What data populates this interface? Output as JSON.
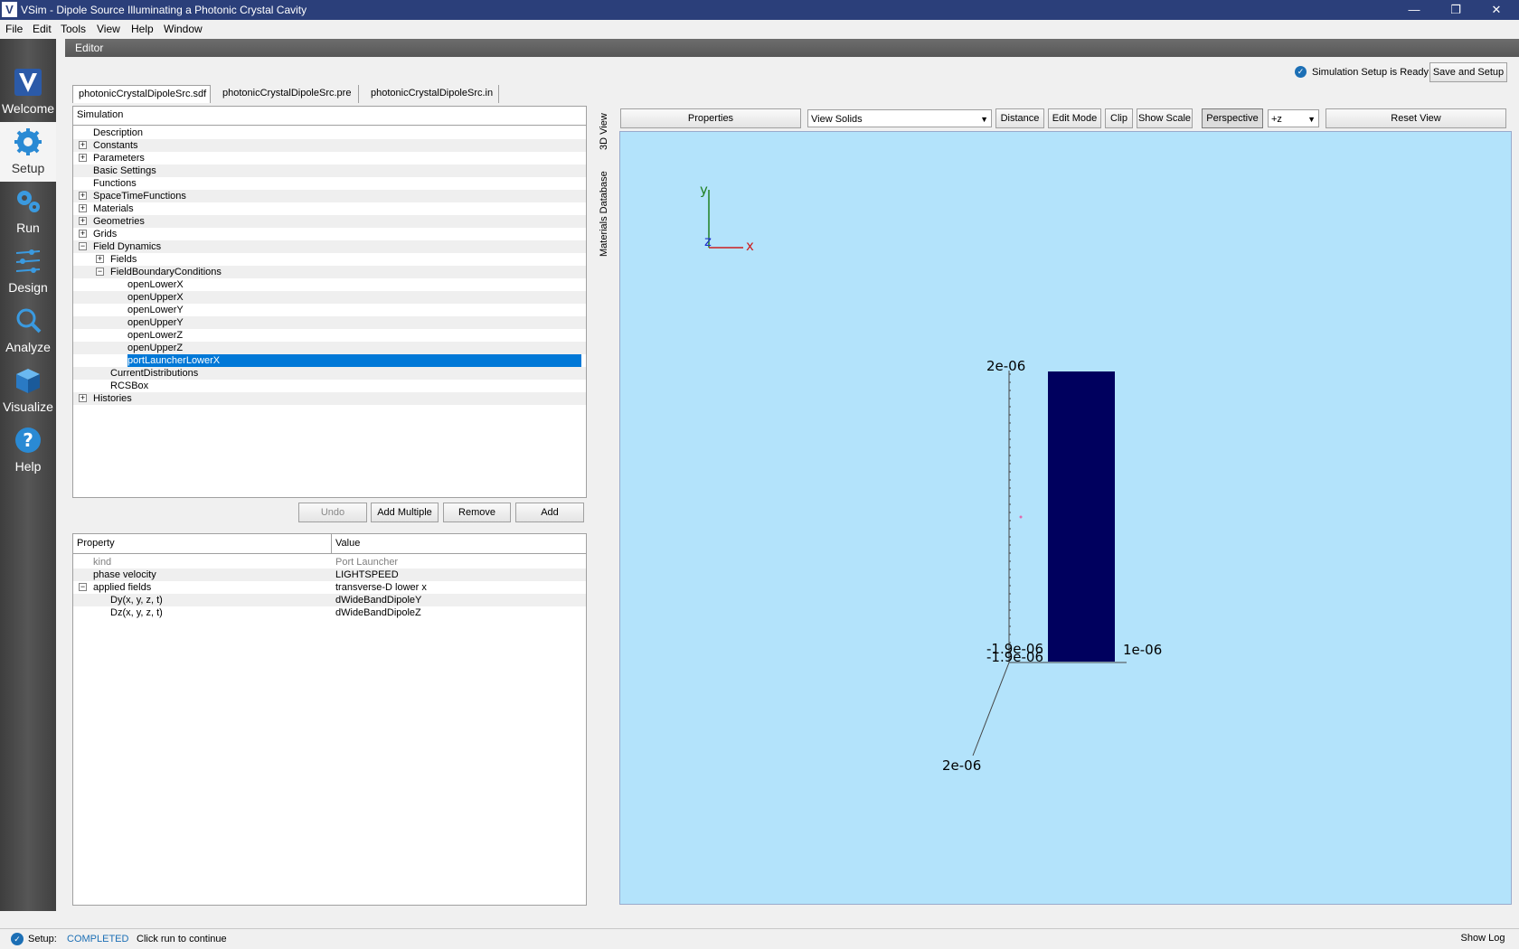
{
  "window": {
    "title": "VSim - Dipole Source Illuminating a Photonic Crystal Cavity",
    "logo_letter": "V",
    "minimize": "—",
    "restore": "❐",
    "close": "✕"
  },
  "menu": [
    "File",
    "Edit",
    "Tools",
    "View",
    "Help",
    "Window"
  ],
  "nav": [
    {
      "label": "Welcome",
      "icon": "vsim-logo-icon"
    },
    {
      "label": "Setup",
      "icon": "gear-icon"
    },
    {
      "label": "Run",
      "icon": "gears-run-icon"
    },
    {
      "label": "Design",
      "icon": "sliders-icon"
    },
    {
      "label": "Analyze",
      "icon": "magnifier-icon"
    },
    {
      "label": "Visualize",
      "icon": "cube-icon"
    },
    {
      "label": "Help",
      "icon": "question-icon"
    }
  ],
  "editor": {
    "header": "Editor",
    "status": "Simulation Setup is Ready",
    "save_button": "Save and Setup",
    "file_tabs": [
      "photonicCrystalDipoleSrc.sdf",
      "photonicCrystalDipoleSrc.pre",
      "photonicCrystalDipoleSrc.in"
    ]
  },
  "tree": {
    "header": "Simulation",
    "rows": [
      {
        "label": "Description",
        "level": 0,
        "expander": ""
      },
      {
        "label": "Constants",
        "level": 0,
        "expander": "+"
      },
      {
        "label": "Parameters",
        "level": 0,
        "expander": "+"
      },
      {
        "label": "Basic Settings",
        "level": 0,
        "expander": ""
      },
      {
        "label": "Functions",
        "level": 0,
        "expander": ""
      },
      {
        "label": "SpaceTimeFunctions",
        "level": 0,
        "expander": "+"
      },
      {
        "label": "Materials",
        "level": 0,
        "expander": "+"
      },
      {
        "label": "Geometries",
        "level": 0,
        "expander": "+"
      },
      {
        "label": "Grids",
        "level": 0,
        "expander": "+"
      },
      {
        "label": "Field Dynamics",
        "level": 0,
        "expander": "−"
      },
      {
        "label": "Fields",
        "level": 1,
        "expander": "+"
      },
      {
        "label": "FieldBoundaryConditions",
        "level": 1,
        "expander": "−"
      },
      {
        "label": "openLowerX",
        "level": 2,
        "expander": ""
      },
      {
        "label": "openUpperX",
        "level": 2,
        "expander": ""
      },
      {
        "label": "openLowerY",
        "level": 2,
        "expander": ""
      },
      {
        "label": "openUpperY",
        "level": 2,
        "expander": ""
      },
      {
        "label": "openLowerZ",
        "level": 2,
        "expander": ""
      },
      {
        "label": "openUpperZ",
        "level": 2,
        "expander": ""
      },
      {
        "label": "portLauncherLowerX",
        "level": 2,
        "expander": "",
        "selected": true
      },
      {
        "label": "CurrentDistributions",
        "level": 1,
        "expander": ""
      },
      {
        "label": "RCSBox",
        "level": 1,
        "expander": ""
      },
      {
        "label": "Histories",
        "level": 0,
        "expander": "+"
      }
    ]
  },
  "actions": {
    "undo": "Undo",
    "add_multiple": "Add Multiple",
    "remove": "Remove",
    "add": "Add"
  },
  "properties": {
    "col_property": "Property",
    "col_value": "Value",
    "rows": [
      {
        "name": "kind",
        "value": "Port Launcher",
        "level": 0,
        "expander": "",
        "disabled": true
      },
      {
        "name": "phase velocity",
        "value": "LIGHTSPEED",
        "level": 0,
        "expander": ""
      },
      {
        "name": "applied fields",
        "value": "transverse-D lower x",
        "level": 0,
        "expander": "−"
      },
      {
        "name": "Dy(x, y, z, t)",
        "value": "dWideBandDipoleY",
        "level": 1,
        "expander": ""
      },
      {
        "name": "Dz(x, y, z, t)",
        "value": "dWideBandDipoleZ",
        "level": 1,
        "expander": ""
      }
    ]
  },
  "side_tabs": [
    "3D View",
    "Materials Database"
  ],
  "view_toolbar": {
    "properties": "Properties",
    "view_mode": "View Solids",
    "distance": "Distance",
    "edit_mode": "Edit Mode",
    "clip": "Clip",
    "show_scale": "Show Scale",
    "perspective": "Perspective",
    "axis_view": "+z",
    "reset_view": "Reset View"
  },
  "viewport": {
    "background": "#b3e3fb",
    "solid_color": "#00005e",
    "axis_labels": {
      "x": "x",
      "y": "y",
      "z": "z"
    },
    "scale_labels": {
      "y_top": "2e-06",
      "y_bottom_1": "-1.9e-06",
      "y_bottom_2": "-1.9e-06",
      "x_right": "1e-06",
      "z_front": "2e-06"
    }
  },
  "status": {
    "label": "Setup:",
    "state": "COMPLETED",
    "message": "Click run to continue",
    "show_log": "Show Log"
  }
}
